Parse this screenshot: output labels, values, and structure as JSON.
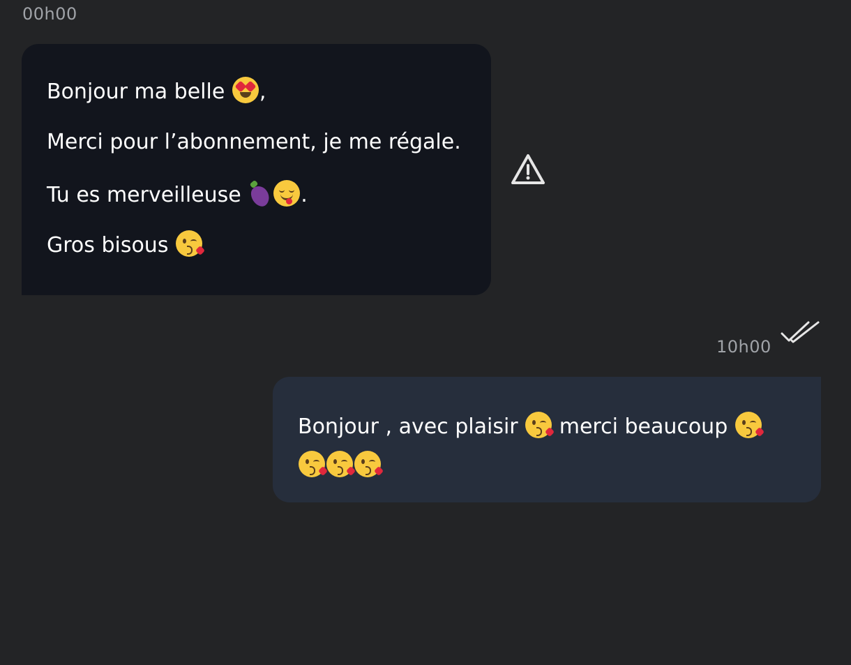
{
  "conversation": {
    "incoming": {
      "time": "00h00",
      "lines": [
        {
          "text": "Bonjour ma belle",
          "suffix": ","
        },
        {
          "text": "Merci pour l’abonnement, je me régale."
        },
        {
          "text": "Tu es merveilleuse",
          "suffix": "."
        },
        {
          "text": "Gros bisous"
        }
      ],
      "status_icon": "warning-icon"
    },
    "outgoing": {
      "time": "10h00",
      "line1_a": "Bonjour , avec plaisir",
      "line1_b": "merci beaucoup",
      "status_icon": "double-check-icon"
    }
  },
  "colors": {
    "background": "#232426",
    "incoming_bubble": "#12151d",
    "outgoing_bubble": "#262e3c",
    "timestamp": "#a0a3a8"
  }
}
